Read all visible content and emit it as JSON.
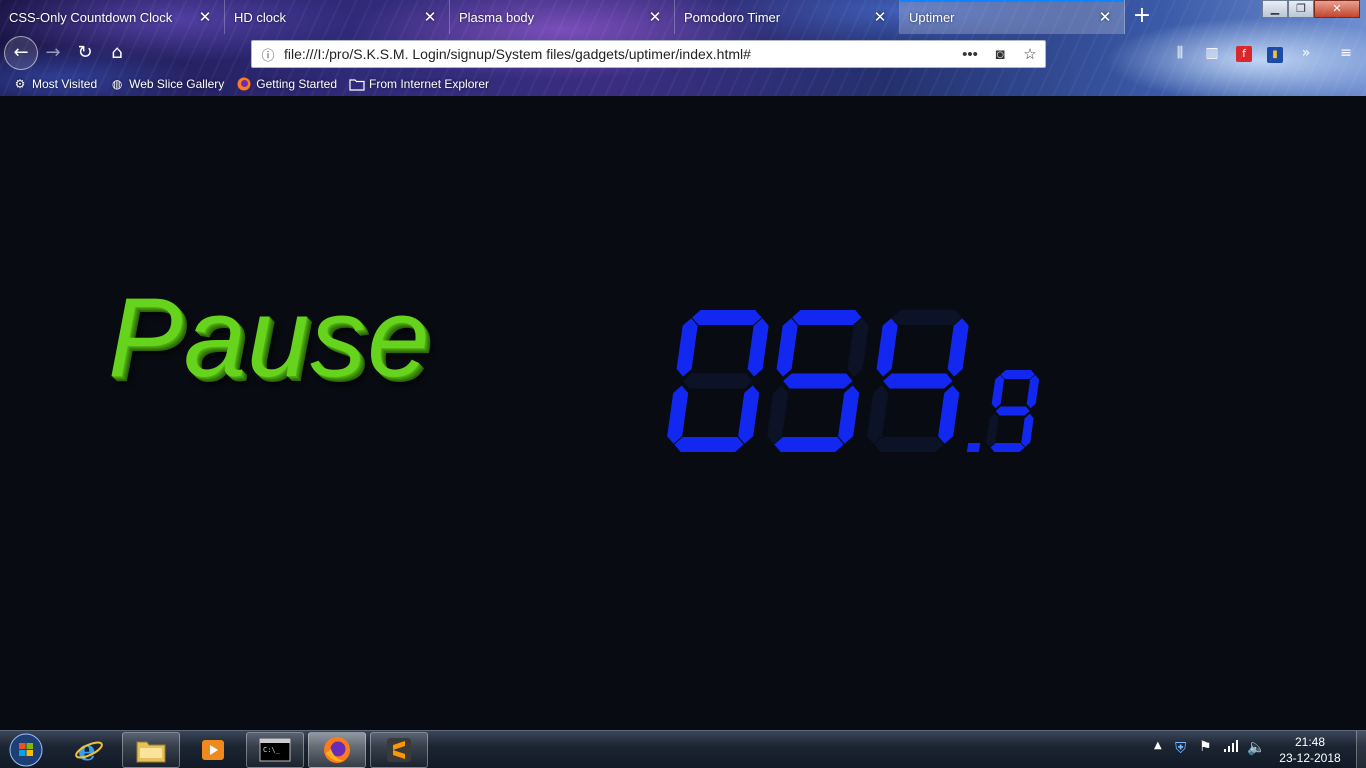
{
  "browser": {
    "tabs": [
      {
        "title": "CSS-Only Countdown Clock",
        "active": false
      },
      {
        "title": "HD clock",
        "active": false
      },
      {
        "title": "Plasma body",
        "active": false
      },
      {
        "title": "Pomodoro Timer",
        "active": false
      },
      {
        "title": "Uptimer",
        "active": true
      }
    ],
    "url": "file:///I:/pro/S.K.S.M. Login/signup/System files/gadgets/uptimer/index.html#",
    "bookmarks": [
      {
        "label": "Most Visited",
        "icon": "gear-icon"
      },
      {
        "label": "Web Slice Gallery",
        "icon": "globe-icon"
      },
      {
        "label": "Getting Started",
        "icon": "firefox-icon"
      },
      {
        "label": "From Internet Explorer",
        "icon": "folder-icon"
      }
    ]
  },
  "page": {
    "status_text": "Pause",
    "timer": {
      "value": "054",
      "fraction": "9",
      "digit_color": "#1228f0",
      "status_color": "#66d31c"
    }
  },
  "taskbar": {
    "apps": [
      "internet-explorer-icon",
      "file-explorer-icon",
      "media-player-icon",
      "command-prompt-icon",
      "firefox-icon",
      "sublime-text-icon"
    ],
    "time": "21:48",
    "date": "23-12-2018"
  }
}
